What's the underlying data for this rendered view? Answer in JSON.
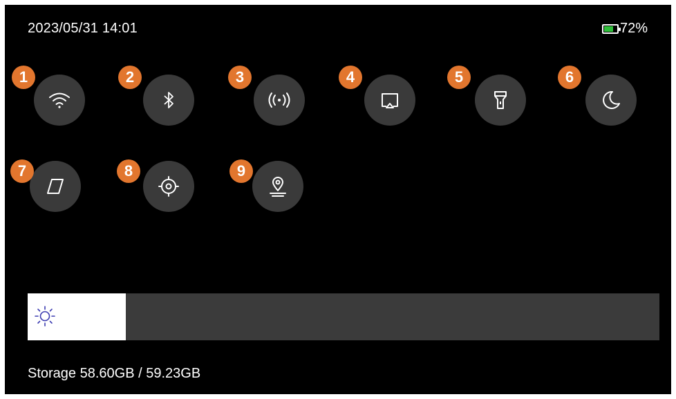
{
  "status_bar": {
    "datetime": "2023/05/31 14:01",
    "battery_percent_label": "72%",
    "battery_level": 0.72
  },
  "quick_settings": [
    {
      "badge": "1",
      "icon": "wifi-icon"
    },
    {
      "badge": "2",
      "icon": "bluetooth-icon"
    },
    {
      "badge": "3",
      "icon": "hotspot-icon"
    },
    {
      "badge": "4",
      "icon": "screen-cast-icon"
    },
    {
      "badge": "5",
      "icon": "flashlight-icon"
    },
    {
      "badge": "6",
      "icon": "dark-mode-icon"
    },
    {
      "badge": "7",
      "icon": "compass-icon"
    },
    {
      "badge": "8",
      "icon": "location-target-icon"
    },
    {
      "badge": "9",
      "icon": "map-pin-icon"
    }
  ],
  "brightness": {
    "icon": "sun-icon",
    "level": 0.155
  },
  "storage": {
    "label": "Storage 58.60GB / 59.23GB"
  },
  "colors": {
    "badge": "#e2762e",
    "tile": "#3a3a3a",
    "background": "#000000",
    "accent": "#3a3ab0"
  }
}
